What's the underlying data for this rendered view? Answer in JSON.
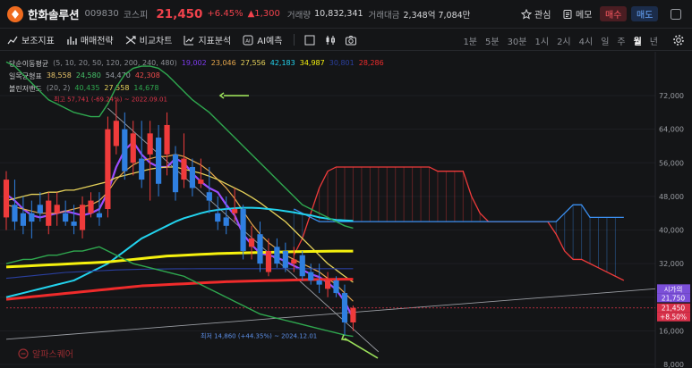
{
  "header": {
    "name": "한화솔루션",
    "code": "009830",
    "market": "코스피",
    "price": "21,450",
    "change_pct": "+6.45%",
    "change_amt": "▲1,300",
    "volume_label": "거래량",
    "volume": "10,832,341",
    "amount_label": "거래대금",
    "amount": "2,348억 7,084만",
    "watch_label": "관심",
    "memo_label": "메모",
    "buy_label": "매수",
    "sell_label": "매도"
  },
  "toolbar": {
    "indicators": "보조지표",
    "strategy": "매매전략",
    "compare": "비교차트",
    "analysis": "지표분석",
    "ai": "AI예측",
    "periods": [
      "1분",
      "5분",
      "30분",
      "1시",
      "2시",
      "4시",
      "일",
      "주",
      "월",
      "년"
    ],
    "active_period": "월"
  },
  "legend": {
    "sma_label": "단순이동평균",
    "sma_params": "(5, 10, 20, 50, 120, 200, 240, 480)",
    "sma_values": [
      {
        "v": "19,002",
        "color": "#7c3aed"
      },
      {
        "v": "23,046",
        "color": "#e8a84c"
      },
      {
        "v": "27,556",
        "color": "#e6d25a"
      },
      {
        "v": "42,183",
        "color": "#22d3ee"
      },
      {
        "v": "34,987",
        "color": "#f5f10e"
      },
      {
        "v": "30,801",
        "color": "#2a3f9e"
      },
      {
        "v": "28,286",
        "color": "#ef2b2b"
      }
    ],
    "ichimoku_label": "일목균형표",
    "ichimoku_values": [
      {
        "v": "38,558",
        "color": "#e8c46a"
      },
      {
        "v": "24,580",
        "color": "#46c46a"
      },
      {
        "v": "54,470",
        "color": "#9aa0a8"
      },
      {
        "v": "42,308",
        "color": "#ef4c4c"
      }
    ],
    "bb_label": "볼린저밴드",
    "bb_params": "(20, 2)",
    "bb_values": [
      {
        "v": "40,435",
        "color": "#2fa84f"
      },
      {
        "v": "27,558",
        "color": "#e6d25a"
      },
      {
        "v": "14,678",
        "color": "#2fa84f"
      }
    ],
    "high_annotation": "최고 57,741 (-69.24%) ~ 2022.09.01"
  },
  "chart_data": {
    "type": "candlestick",
    "y_axis": {
      "scale": "linear",
      "ylim": [
        8000,
        82000
      ],
      "ticks": [
        8000,
        16000,
        24000,
        32000,
        40000,
        48000,
        56000,
        64000,
        72000
      ]
    },
    "candles": [
      {
        "o": 43000,
        "h": 54000,
        "l": 40000,
        "c": 52000
      },
      {
        "o": 46000,
        "h": 52000,
        "l": 40000,
        "c": 42000
      },
      {
        "o": 44000,
        "h": 48000,
        "l": 39000,
        "c": 41000
      },
      {
        "o": 44000,
        "h": 47000,
        "l": 38000,
        "c": 42000
      },
      {
        "o": 46000,
        "h": 49000,
        "l": 42000,
        "c": 44000
      },
      {
        "o": 41000,
        "h": 49000,
        "l": 39000,
        "c": 47000
      },
      {
        "o": 44000,
        "h": 49000,
        "l": 41000,
        "c": 46000
      },
      {
        "o": 44000,
        "h": 47000,
        "l": 41000,
        "c": 42000
      },
      {
        "o": 42000,
        "h": 46000,
        "l": 39000,
        "c": 41000
      },
      {
        "o": 40000,
        "h": 48000,
        "l": 38000,
        "c": 46000
      },
      {
        "o": 44000,
        "h": 49000,
        "l": 43000,
        "c": 47000
      },
      {
        "o": 44000,
        "h": 49000,
        "l": 41000,
        "c": 43000
      },
      {
        "o": 45000,
        "h": 67000,
        "l": 43000,
        "c": 64000
      },
      {
        "o": 60000,
        "h": 71000,
        "l": 58000,
        "c": 66000
      },
      {
        "o": 64000,
        "h": 68000,
        "l": 52000,
        "c": 54000
      },
      {
        "o": 56000,
        "h": 66000,
        "l": 53000,
        "c": 63000
      },
      {
        "o": 57000,
        "h": 66000,
        "l": 50000,
        "c": 52000
      },
      {
        "o": 58000,
        "h": 66000,
        "l": 47000,
        "c": 63000
      },
      {
        "o": 62000,
        "h": 65000,
        "l": 48000,
        "c": 51000
      },
      {
        "o": 58000,
        "h": 68000,
        "l": 53000,
        "c": 65000
      },
      {
        "o": 58000,
        "h": 60000,
        "l": 47000,
        "c": 49000
      },
      {
        "o": 52000,
        "h": 63000,
        "l": 50000,
        "c": 57000
      },
      {
        "o": 55000,
        "h": 57000,
        "l": 48000,
        "c": 50000
      },
      {
        "o": 51000,
        "h": 57000,
        "l": 50000,
        "c": 52000
      },
      {
        "o": 49000,
        "h": 55000,
        "l": 44000,
        "c": 47000
      },
      {
        "o": 44000,
        "h": 48000,
        "l": 40000,
        "c": 42000
      },
      {
        "o": 43000,
        "h": 48000,
        "l": 39000,
        "c": 41000
      },
      {
        "o": 44000,
        "h": 50000,
        "l": 42000,
        "c": 45000
      },
      {
        "o": 45000,
        "h": 46000,
        "l": 33000,
        "c": 35000
      },
      {
        "o": 36000,
        "h": 41000,
        "l": 33000,
        "c": 38000
      },
      {
        "o": 39000,
        "h": 42000,
        "l": 30000,
        "c": 32000
      },
      {
        "o": 30000,
        "h": 38000,
        "l": 29000,
        "c": 35000
      },
      {
        "o": 36000,
        "h": 38000,
        "l": 31000,
        "c": 32000
      },
      {
        "o": 35000,
        "h": 37000,
        "l": 30000,
        "c": 31000
      },
      {
        "o": 32000,
        "h": 36000,
        "l": 30000,
        "c": 33000
      },
      {
        "o": 34000,
        "h": 35000,
        "l": 28000,
        "c": 29000
      },
      {
        "o": 30000,
        "h": 32000,
        "l": 27000,
        "c": 28000
      },
      {
        "o": 28000,
        "h": 32000,
        "l": 25000,
        "c": 27000
      },
      {
        "o": 26000,
        "h": 30000,
        "l": 24000,
        "c": 28000
      },
      {
        "o": 28000,
        "h": 29000,
        "l": 24000,
        "c": 25000
      },
      {
        "o": 25000,
        "h": 27000,
        "l": 15000,
        "c": 18000
      },
      {
        "o": 18000,
        "h": 22000,
        "l": 16000,
        "c": 21450
      }
    ],
    "lines": [
      {
        "name": "MA5",
        "color": "#9b4dff",
        "width": 2.2,
        "values": [
          48500,
          47000,
          45000,
          43500,
          43000,
          43500,
          44000,
          44500,
          44000,
          43500,
          44000,
          45000,
          49000,
          55000,
          59000,
          61000,
          58000,
          56000,
          55000,
          55000,
          57000,
          56000,
          53500,
          51500,
          50000,
          49000,
          46000,
          43500,
          39000,
          36500,
          34500,
          34000,
          33500,
          32500,
          31500,
          30500,
          29500,
          28800,
          27500,
          25800,
          23000,
          19002
        ]
      },
      {
        "name": "MA10",
        "color": "#e8a84c",
        "width": 1.2,
        "values": [
          46000,
          45500,
          45000,
          44500,
          44000,
          44000,
          44000,
          44500,
          45000,
          45500,
          46000,
          47000,
          49000,
          52000,
          54000,
          55500,
          56500,
          57000,
          57500,
          57500,
          58000,
          57500,
          56500,
          55500,
          54000,
          52000,
          50000,
          47500,
          44500,
          41500,
          39000,
          37000,
          35500,
          34000,
          33000,
          32000,
          31000,
          30000,
          28500,
          27000,
          25000,
          23046
        ]
      },
      {
        "name": "MA20",
        "color": "#e6d25a",
        "width": 1.3,
        "values": [
          47000,
          47500,
          48000,
          48500,
          48500,
          49000,
          49000,
          49500,
          49500,
          50000,
          50500,
          51000,
          51500,
          52500,
          53000,
          53500,
          54000,
          54500,
          54800,
          55000,
          55000,
          54500,
          54000,
          53500,
          52800,
          52000,
          51000,
          50000,
          49000,
          47800,
          46500,
          45000,
          43500,
          42000,
          40000,
          38000,
          36000,
          34000,
          32000,
          30500,
          29000,
          27556
        ]
      },
      {
        "name": "MA50",
        "color": "#22d3ee",
        "width": 2.0,
        "values": [
          24000,
          24500,
          25000,
          25500,
          26000,
          26500,
          27000,
          27500,
          28000,
          29000,
          30000,
          31000,
          32000,
          33500,
          35000,
          36500,
          38000,
          39000,
          40000,
          41000,
          42000,
          42800,
          43400,
          44000,
          44500,
          44800,
          45000,
          45200,
          45300,
          45300,
          45200,
          45000,
          44800,
          44500,
          44200,
          43800,
          43500,
          43000,
          42700,
          42400,
          42300,
          42183
        ]
      },
      {
        "name": "MA120",
        "color": "#f5f10e",
        "width": 3.0,
        "values": [
          31200,
          31300,
          31400,
          31500,
          31600,
          31700,
          31800,
          31900,
          32000,
          32100,
          32200,
          32300,
          32400,
          32600,
          32800,
          33000,
          33200,
          33400,
          33600,
          33800,
          33900,
          34000,
          34100,
          34200,
          34300,
          34400,
          34450,
          34500,
          34550,
          34600,
          34650,
          34700,
          34750,
          34800,
          34850,
          34880,
          34900,
          34930,
          34950,
          34970,
          34980,
          34987
        ]
      },
      {
        "name": "MA200",
        "color": "#2a3f9e",
        "width": 1.1,
        "values": [
          28500,
          28700,
          28900,
          29100,
          29300,
          29500,
          29700,
          29900,
          30000,
          30100,
          30200,
          30300,
          30400,
          30500,
          30550,
          30600,
          30650,
          30700,
          30720,
          30740,
          30760,
          30770,
          30780,
          30790,
          30795,
          30800,
          30801,
          30801,
          30801,
          30801,
          30801,
          30801,
          30801,
          30801,
          30801,
          30801,
          30801,
          30801,
          30801,
          30801,
          30801,
          30801
        ]
      },
      {
        "name": "MA240",
        "color": "#ef2b2b",
        "width": 3.0,
        "values": [
          23500,
          23700,
          23900,
          24100,
          24300,
          24500,
          24700,
          24900,
          25100,
          25300,
          25500,
          25700,
          25900,
          26100,
          26300,
          26500,
          26700,
          26800,
          26900,
          27000,
          27100,
          27200,
          27300,
          27400,
          27500,
          27600,
          27700,
          27750,
          27800,
          27850,
          27900,
          27950,
          28000,
          28050,
          28100,
          28150,
          28200,
          28220,
          28240,
          28260,
          28275,
          28286
        ]
      },
      {
        "name": "BB Upper",
        "color": "#2fa84f",
        "width": 1.4,
        "values": [
          80000,
          79000,
          77000,
          75000,
          73000,
          71000,
          70000,
          69000,
          68000,
          67500,
          67000,
          67000,
          70000,
          74000,
          77000,
          78500,
          79000,
          79000,
          78500,
          77000,
          75000,
          73000,
          71000,
          69500,
          68000,
          66000,
          64000,
          62000,
          60000,
          58000,
          56000,
          54000,
          52000,
          50000,
          48000,
          46000,
          45000,
          44000,
          43000,
          42000,
          41000,
          40435
        ]
      },
      {
        "name": "BB Lower",
        "color": "#2fa84f",
        "width": 1.4,
        "values": [
          32000,
          32500,
          33000,
          33000,
          33500,
          34000,
          34000,
          34500,
          35000,
          35000,
          35500,
          36000,
          35000,
          34000,
          33000,
          32000,
          31500,
          31000,
          30500,
          30000,
          29500,
          29000,
          28000,
          27000,
          26000,
          25000,
          24000,
          23000,
          22000,
          21000,
          20000,
          19500,
          19000,
          18500,
          18000,
          17500,
          17000,
          16500,
          16000,
          15500,
          15000,
          14678
        ]
      }
    ],
    "cloud": {
      "line1_color": "#ef3b3b",
      "line2_color": "#3b8ff0",
      "x_start": 34,
      "span1": [
        34000,
        38000,
        44000,
        50000,
        54000,
        55000,
        55000,
        55000,
        55000,
        55000,
        55000,
        55000,
        55000,
        55000,
        55000,
        55000,
        55000,
        54000,
        54000,
        54000,
        54000,
        48000,
        44000,
        42000,
        42000,
        42000,
        42000,
        42000,
        42000,
        42000,
        42000,
        39000,
        35000,
        33000,
        33000,
        32000,
        31000,
        30000,
        29000,
        28000
      ],
      "span2": [
        45000,
        44000,
        43000,
        42000,
        42000,
        42000,
        42000,
        42000,
        42000,
        42000,
        42000,
        42000,
        42000,
        42000,
        42000,
        42000,
        42000,
        42000,
        42000,
        42000,
        42000,
        42000,
        42000,
        42000,
        42000,
        42000,
        42000,
        42000,
        42000,
        42000,
        42000,
        42000,
        44000,
        46000,
        46000,
        43000,
        43000,
        43000,
        43000,
        43000
      ]
    },
    "price_labels": [
      {
        "text": "시가의",
        "value": 21750,
        "color": "#9b4dff"
      },
      {
        "text": "21,750",
        "value": 21750,
        "color": "#9b4dff"
      },
      {
        "text": "21,450",
        "value": 21450,
        "color": "#e0344a"
      },
      {
        "text": "+8.50%",
        "value": 21450,
        "color": "#e0344a"
      }
    ],
    "low_annotation": "최저 14,860 (+44.35%) ~ 2024.12.01"
  },
  "footer": {
    "brand": "알파스퀘어"
  }
}
